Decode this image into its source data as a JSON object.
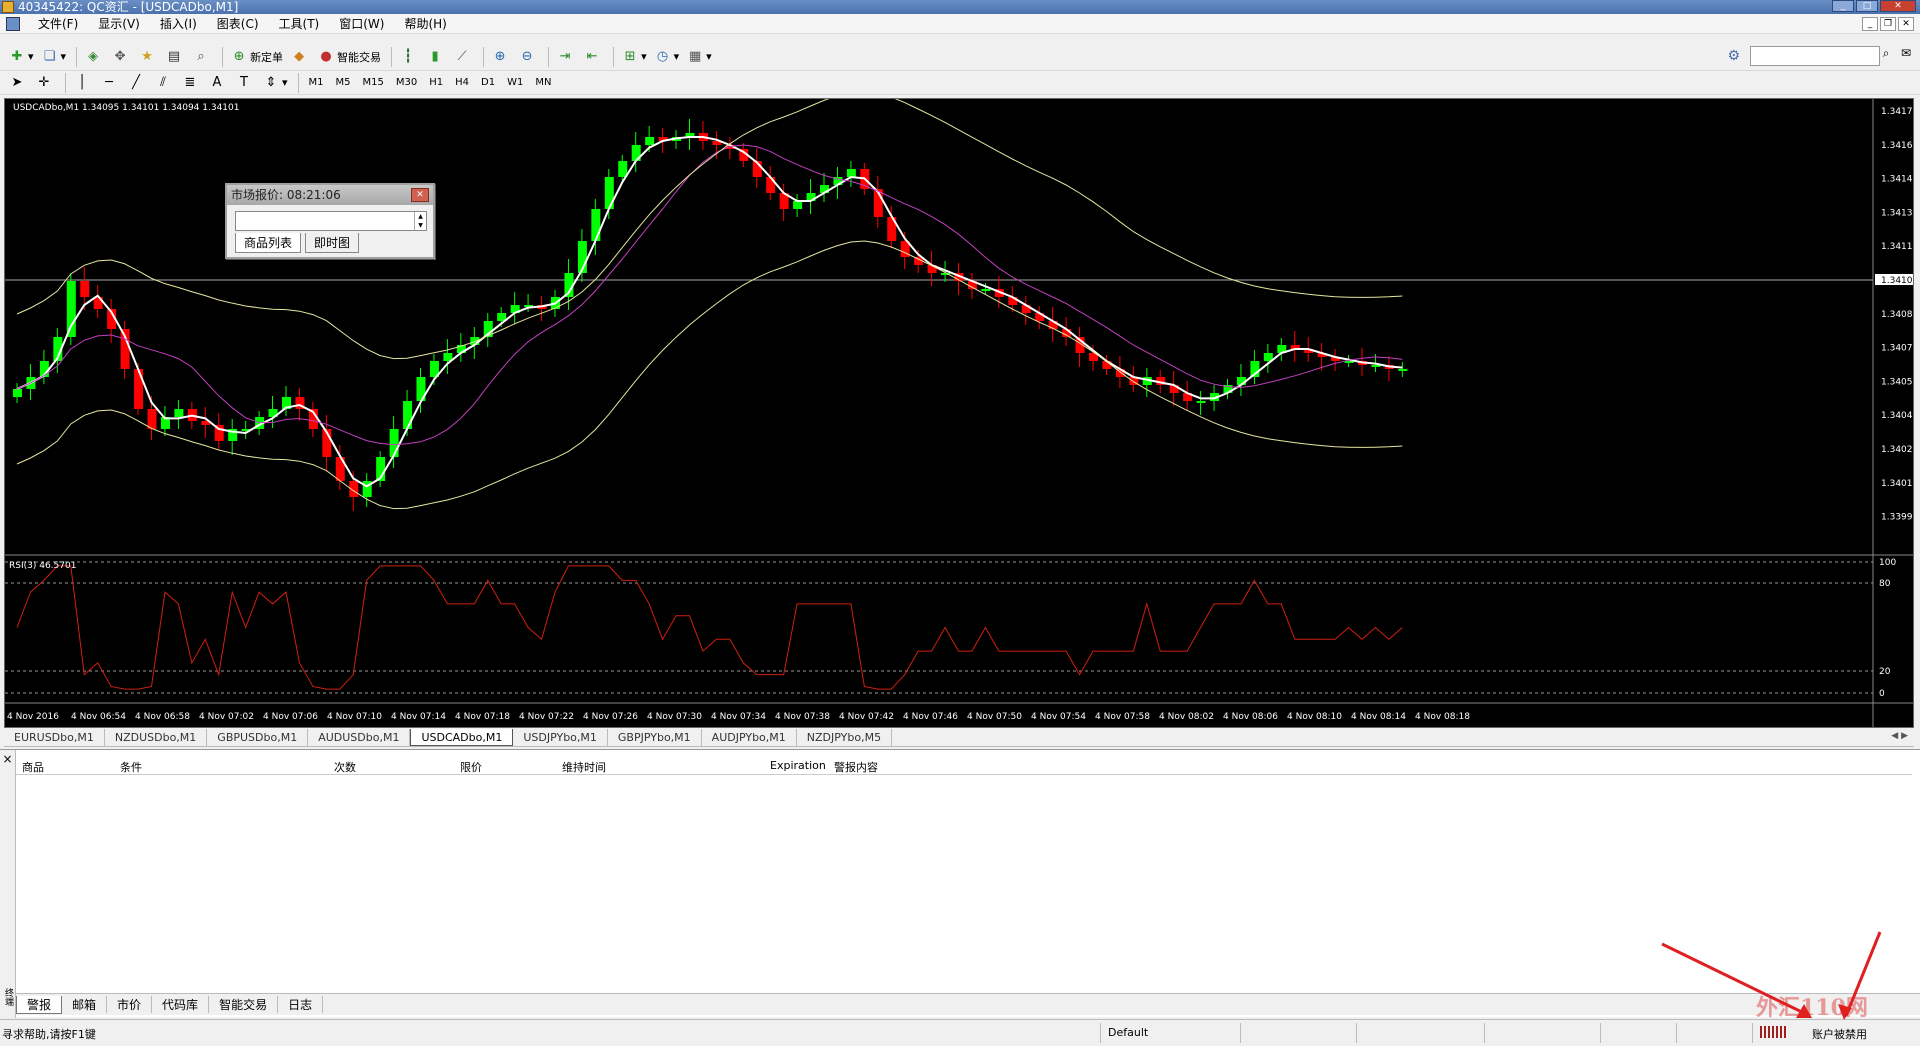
{
  "window": {
    "title": "40345422: QC资汇 - [USDCADbo,M1]"
  },
  "menu": {
    "items": [
      "文件(F)",
      "显示(V)",
      "插入(I)",
      "图表(C)",
      "工具(T)",
      "窗口(W)",
      "帮助(H)"
    ]
  },
  "toolbar": {
    "new_order": "新定单",
    "smart_trade": "智能交易",
    "timeframes": [
      "M1",
      "M5",
      "M15",
      "M30",
      "H1",
      "H4",
      "D1",
      "W1",
      "MN"
    ],
    "active_timeframe": "M1"
  },
  "chart": {
    "header": "USDCADbo,M1  1.34095 1.34101 1.34094 1.34101",
    "current_price": "1.34101",
    "price_labels": [
      "1.34175",
      "1.34160",
      "1.34145",
      "1.34130",
      "1.34115",
      "1.34101",
      "1.34085",
      "1.34070",
      "1.34055",
      "1.34040",
      "1.34025",
      "1.34010",
      "1.33995"
    ],
    "rsi_header": "RSI(3) 46.5701",
    "rsi_labels": [
      "100",
      "80",
      "20",
      "0"
    ],
    "time_labels": [
      "4 Nov 2016",
      "4 Nov 06:54",
      "4 Nov 06:58",
      "4 Nov 07:02",
      "4 Nov 07:06",
      "4 Nov 07:10",
      "4 Nov 07:14",
      "4 Nov 07:18",
      "4 Nov 07:22",
      "4 Nov 07:26",
      "4 Nov 07:30",
      "4 Nov 07:34",
      "4 Nov 07:38",
      "4 Nov 07:42",
      "4 Nov 07:46",
      "4 Nov 07:50",
      "4 Nov 07:54",
      "4 Nov 07:58",
      "4 Nov 08:02",
      "4 Nov 08:06",
      "4 Nov 08:10",
      "4 Nov 08:14",
      "4 Nov 08:18"
    ],
    "colors": {
      "bull": "#00ff00",
      "bear": "#ff0000",
      "ma_fast": "#ffffff",
      "ma_slow": "#c040c0",
      "bands": "#e6e6a0",
      "rsi": "#d02010"
    }
  },
  "market_window": {
    "title": "市场报价: 08:21:06",
    "tab_symbols": "商品列表",
    "tab_tick": "即时图"
  },
  "symbol_tabs": [
    "EURUSDbo,M1",
    "NZDUSDbo,M1",
    "GBPUSDbo,M1",
    "AUDUSDbo,M1",
    "USDCADbo,M1",
    "USDJPYbo,M1",
    "GBPJPYbo,M1",
    "AUDJPYbo,M1",
    "NZDJPYbo,M5"
  ],
  "active_symbol_tab": "USDCADbo,M1",
  "terminal": {
    "side_label": "终端",
    "columns": [
      "商品",
      "条件",
      "次数",
      "限价",
      "维持时间",
      "Expiration",
      "警报内容"
    ],
    "tabs": [
      "警报",
      "邮箱",
      "市价",
      "代码库",
      "智能交易",
      "日志"
    ]
  },
  "status": {
    "help": "寻求帮助,请按F1键",
    "profile": "Default",
    "connection": "账户被禁用"
  },
  "watermark": "外汇110网"
}
